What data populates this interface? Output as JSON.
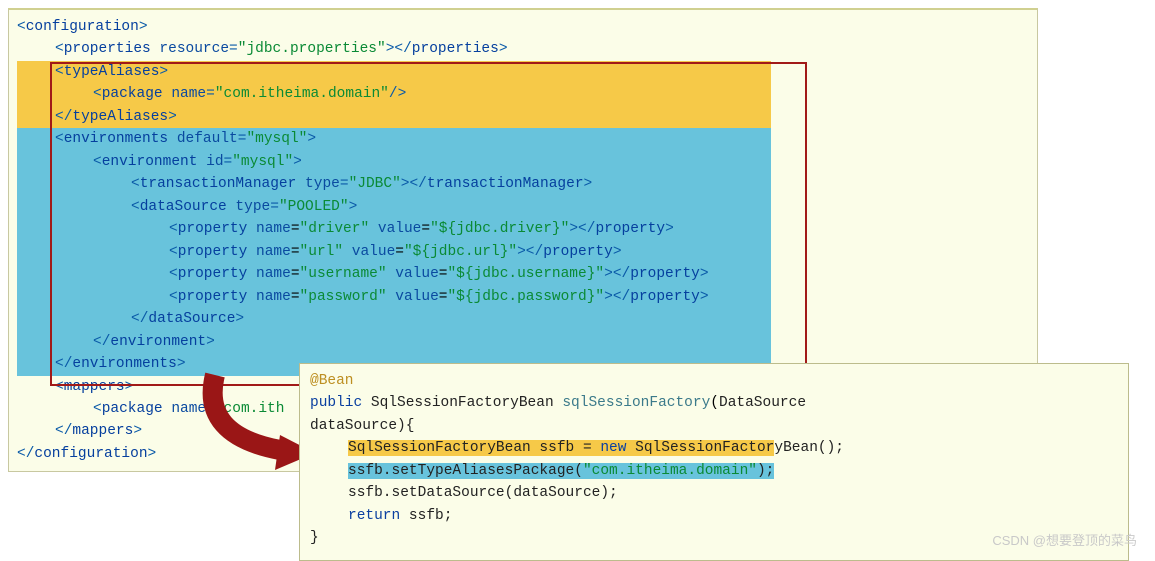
{
  "xml": {
    "l1": {
      "o": "<",
      "tag": "configuration",
      "c": ">"
    },
    "l2": {
      "o": "<",
      "tag": "properties",
      "attr": "resource",
      "eq": "=",
      "val": "\"jdbc.properties\"",
      "c1": "></",
      "tag2": "properties",
      "c2": ">"
    },
    "l3": {
      "o": "<",
      "tag": "typeAliases",
      "c": ">"
    },
    "l4": {
      "o": "<",
      "tag": "package",
      "attr": "name",
      "eq": "=",
      "val": "\"com.itheima.domain\"",
      "c": "/>"
    },
    "l5": {
      "o": "</",
      "tag": "typeAliases",
      "c": ">"
    },
    "l6": {
      "o": "<",
      "tag": "environments",
      "attr": "default",
      "eq": "=",
      "val": "\"mysql\"",
      "c": ">"
    },
    "l7": {
      "o": "<",
      "tag": "environment",
      "attr": "id",
      "eq": "=",
      "val": "\"mysql\"",
      "c": ">"
    },
    "l8": {
      "o": "<",
      "tag": "transactionManager",
      "attr": "type",
      "eq": "=",
      "val": "\"JDBC\"",
      "c1": "></",
      "tag2": "transactionManager",
      "c2": ">"
    },
    "l9": {
      "o": "<",
      "tag": "dataSource",
      "attr": "type",
      "eq": "=",
      "val": "\"POOLED\"",
      "c": ">"
    },
    "l10": {
      "o": "<",
      "tag": "property",
      "attr1": "name",
      "val1": "\"driver\"",
      "attr2": "value",
      "val2": "\"${jdbc.driver}\"",
      "c1": "></",
      "tag2": "property",
      "c2": ">"
    },
    "l11": {
      "o": "<",
      "tag": "property",
      "attr1": "name",
      "val1": "\"url\"",
      "attr2": "value",
      "val2": "\"${jdbc.url}\"",
      "c1": "></",
      "tag2": "property",
      "c2": ">"
    },
    "l12": {
      "o": "<",
      "tag": "property",
      "attr1": "name",
      "val1": "\"username\"",
      "attr2": "value",
      "val2": "\"${jdbc.username}\"",
      "c1": "></",
      "tag2": "property",
      "c2": ">"
    },
    "l13": {
      "o": "<",
      "tag": "property",
      "attr1": "name",
      "val1": "\"password\"",
      "attr2": "value",
      "val2": "\"${jdbc.password}\"",
      "c1": "></",
      "tag2": "property",
      "c2": ">"
    },
    "l14": {
      "o": "</",
      "tag": "dataSource",
      "c": ">"
    },
    "l15": {
      "o": "</",
      "tag": "environment",
      "c": ">"
    },
    "l16": {
      "o": "</",
      "tag": "environments",
      "c": ">"
    },
    "l17": {
      "o": "<",
      "tag": "mappers",
      "c": ">"
    },
    "l18": {
      "o": "<",
      "tag": "package",
      "attr": "name",
      "eq": "=",
      "val": "\"com.ith"
    },
    "l19": {
      "o": "</",
      "tag": "mappers",
      "c": ">"
    },
    "l20": {
      "o": "</",
      "tag": "configuration",
      "c": ">"
    }
  },
  "java": {
    "anno": "@Bean",
    "kw_public": "public",
    "type1": "SqlSessionFactoryBean",
    "method": "sqlSessionFactory",
    "ptype": "DataSource",
    "pname": "dataSource",
    "brace_open": "){",
    "line3a": "SqlSessionFactoryBean ssfb = ",
    "kw_new": "new",
    "line3b": " SqlSessionFactor",
    "line3c": "yBean();",
    "line4a": "ssfb.setTypeAliasesPackage(",
    "line4str": "\"com.itheima.domain\"",
    "line4b": ");",
    "line5": "ssfb.setDataSource(dataSource);",
    "kw_return": "return",
    "line6b": " ssfb;",
    "brace_close": "}"
  },
  "watermark": "CSDN @想要登顶的菜鸟"
}
